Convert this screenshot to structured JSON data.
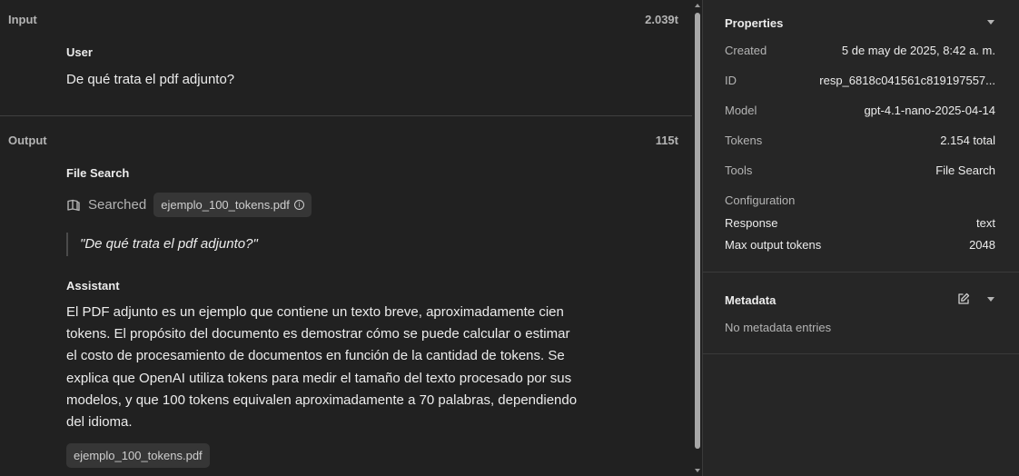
{
  "input": {
    "header": "Input",
    "tokens": "2.039t",
    "role": "User",
    "message": "De qué trata el pdf adjunto?"
  },
  "output": {
    "header": "Output",
    "tokens": "115t",
    "tool_role": "File Search",
    "searched_label": "Searched",
    "searched_file": "ejemplo_100_tokens.pdf",
    "query": "\"De qué trata el pdf adjunto?\"",
    "assistant_role": "Assistant",
    "assistant_lines": [
      "El PDF adjunto es un ejemplo que contiene un texto breve, aproximadamente cien",
      "tokens. El propósito del documento es demostrar cómo se puede calcular o estimar",
      "el costo de procesamiento de documentos en función de la cantidad de tokens. Se",
      "explica que OpenAI utiliza tokens para medir el tamaño del texto procesado por sus",
      "modelos, y que 100 tokens equivalen aproximadamente a 70 palabras, dependiendo",
      "del idioma."
    ],
    "attachment": "ejemplo_100_tokens.pdf"
  },
  "properties": {
    "title": "Properties",
    "rows": [
      {
        "label": "Created",
        "value": "5 de may de 2025, 8:42 a. m."
      },
      {
        "label": "ID",
        "value": "resp_6818c041561c819197557..."
      },
      {
        "label": "Model",
        "value": "gpt-4.1-nano-2025-04-14"
      },
      {
        "label": "Tokens",
        "value": "2.154 total"
      },
      {
        "label": "Tools",
        "value": "File Search"
      }
    ],
    "configuration_label": "Configuration",
    "config_rows": [
      {
        "label": "Response",
        "value": "text"
      },
      {
        "label": "Max output tokens",
        "value": "2048"
      }
    ]
  },
  "metadata": {
    "title": "Metadata",
    "empty_text": "No metadata entries"
  },
  "icons": {
    "searched": "book-icon",
    "info": "info-icon",
    "edit": "edit-icon",
    "collapse": "chevron-down-icon"
  }
}
